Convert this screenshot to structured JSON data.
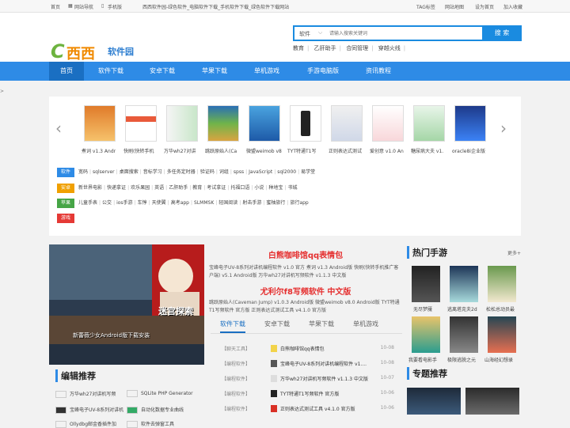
{
  "topbar": {
    "home": "首页",
    "site_nav": "网站导航",
    "mobile": "手机版",
    "slogan": "西西软件园-绿色软件_电脑软件下载_手机软件下载_绿色软件下载网站",
    "tags": "TAG标签",
    "sitemap": "网站地图",
    "set_home": "设为首页",
    "favorite": "加入收藏"
  },
  "logo": {
    "mark": "C",
    "name": "西西",
    "sub": "软件园"
  },
  "search": {
    "category": "软件",
    "placeholder": "请输入搜索关键词",
    "button": "搜 索",
    "hot": [
      "教育",
      "乙肝助手",
      "合同管理",
      "穿越火线"
    ]
  },
  "nav": [
    "首页",
    "软件下载",
    "安卓下载",
    "苹果下载",
    "单机游戏",
    "手游电脑版",
    "资讯教程"
  ],
  "carousel": {
    "captions": [
      "煮词 v1.3 Andr",
      "快刷(快转手机",
      "万华wh27对讲",
      "跳跃原始人(Ca",
      "微盟weimob v8",
      "TYT特通T1写",
      "正则表达式测试",
      "爱创意 v1.0 An",
      "糖尿病大夫 v1.",
      "oracle8i企业版"
    ]
  },
  "tag_rows": [
    {
      "label": "软件",
      "color": "#2e8be6",
      "items": [
        "宽码",
        "sqlserver",
        "桌面搜索",
        "音标学习",
        "多任务定时器",
        "验证码",
        "词组",
        "spss",
        "JavaScript",
        "sql2000",
        "易学堂"
      ]
    },
    {
      "label": "安卓",
      "color": "#f0a000",
      "items": [
        "新世界电影",
        "快递拿证",
        "欢乐果园",
        "英语",
        "乙肝助手",
        "教育",
        "考试拿证",
        "托福口语",
        "小说",
        "种地宝",
        "书城"
      ]
    },
    {
      "label": "苹果",
      "color": "#46a546",
      "items": [
        "儿童手表",
        "公交",
        "ios手游",
        "车惇",
        "天使翼",
        "高考app",
        "SLMMSK",
        "轻国阅读",
        "射击手游",
        "蜜柚旅行",
        "旅行app"
      ]
    },
    {
      "label": "游戏",
      "color": "#e53935",
      "items": []
    }
  ],
  "feature": {
    "banner_text": "迷宫探索",
    "caption": "新蕾薇少女Android版下载安装"
  },
  "headline": {
    "title1": "白熊咖啡馆qq表情包",
    "lines1": [
      "宝峰电子UV-8系列对讲机编程软件 v1.0 官方",
      "煮词 v1.3 Android版",
      "快刷(快转手机推广客户端) v5.1 Android版",
      "万华wh27对讲机写频软件 v1.1.3 中文版"
    ],
    "title2": "尤利尔f8写频软件 中文版",
    "lines2": [
      "跳跃原始人(Caveman Jump) v1.0.3 Android版",
      "微盟weimob v8.0 Android版",
      "TYT特通T1写频软件 官方版",
      "正则表达式测试工具 v4.1.0 官方版"
    ]
  },
  "tabs": [
    "软件下载",
    "安卓下载",
    "苹果下载",
    "单机游戏"
  ],
  "list": [
    {
      "cat": "【聊天工具】",
      "title": "白熊咖啡馆qq表情包",
      "date": "10-08",
      "color": "#f2d34a"
    },
    {
      "cat": "【编程软件】",
      "title": "宝峰电子UV-8系列对讲机编程软件 v1....",
      "date": "10-08",
      "color": "#555"
    },
    {
      "cat": "【编程软件】",
      "title": "万华wh27对讲机写频软件 v1.1.3 中文版",
      "date": "10-07",
      "color": "#ddd"
    },
    {
      "cat": "【编程软件】",
      "title": "TYT特通T1写频软件 官方版",
      "date": "10-06",
      "color": "#222"
    },
    {
      "cat": "【编程软件】",
      "title": "正则表达式测试工具 v4.1.0 官方版",
      "date": "10-06",
      "color": "#d93025"
    }
  ],
  "hot_games": {
    "title": "热门手游",
    "more": "更多+",
    "items": [
      "无尽梦魇",
      "逃离塔克夫2d",
      "松松总动员最",
      "我要看电影手",
      "极限逃脱之元",
      "山海经幻想录"
    ]
  },
  "editor": {
    "title": "编辑推荐",
    "rows": [
      [
        "万华wh27对讲机写频",
        "SQLite PHP Generator"
      ],
      [
        "宝峰电子UV-8系列对讲机",
        "自动化数据专业曲线"
      ],
      [
        "Ollydbg邮金香插件加",
        "软件去弹窗工具"
      ]
    ]
  },
  "topic": {
    "title": "专题推荐"
  }
}
